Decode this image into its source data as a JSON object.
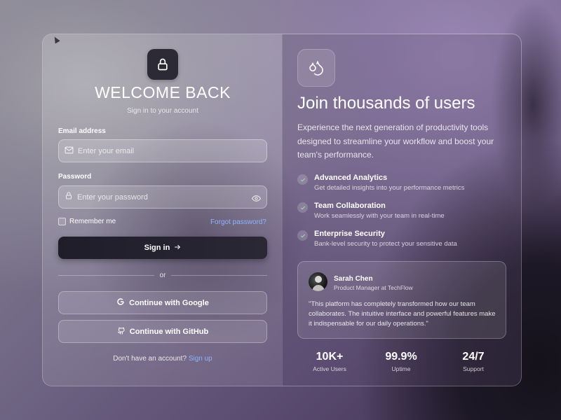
{
  "login": {
    "title": "WELCOME BACK",
    "subtitle": "Sign in to your account",
    "email_label": "Email address",
    "email_placeholder": "Enter your email",
    "password_label": "Password",
    "password_placeholder": "Enter your password",
    "remember_label": "Remember me",
    "forgot_label": "Forgot password?",
    "signin_label": "Sign in",
    "divider_text": "or",
    "google_label": "Continue with Google",
    "github_label": "Continue with GitHub",
    "signup_prompt": "Don't have an account?",
    "signup_link": "Sign up"
  },
  "promo": {
    "title": "Join thousands of users",
    "description": "Experience the next generation of productivity tools designed to streamline your workflow and boost your team's performance.",
    "features": [
      {
        "title": "Advanced Analytics",
        "desc": "Get detailed insights into your performance metrics"
      },
      {
        "title": "Team Collaboration",
        "desc": "Work seamlessly with your team in real-time"
      },
      {
        "title": "Enterprise Security",
        "desc": "Bank-level security to protect your sensitive data"
      }
    ],
    "testimonial": {
      "name": "Sarah Chen",
      "role": "Product Manager at TechFlow",
      "quote": "\"This platform has completely transformed how our team collaborates. The intuitive interface and powerful features make it indispensable for our daily operations.\""
    },
    "stats": [
      {
        "value": "10K+",
        "label": "Active Users"
      },
      {
        "value": "99.9%",
        "label": "Uptime"
      },
      {
        "value": "24/7",
        "label": "Support"
      }
    ]
  },
  "colors": {
    "accent_link": "#8fb3ff",
    "button_dark": "#1f1d2a"
  },
  "icons": [
    "lock-icon",
    "water-drops-icon",
    "mail-icon",
    "password-lock-icon",
    "eye-icon",
    "arrow-right-icon",
    "google-icon",
    "github-icon",
    "check-icon"
  ]
}
